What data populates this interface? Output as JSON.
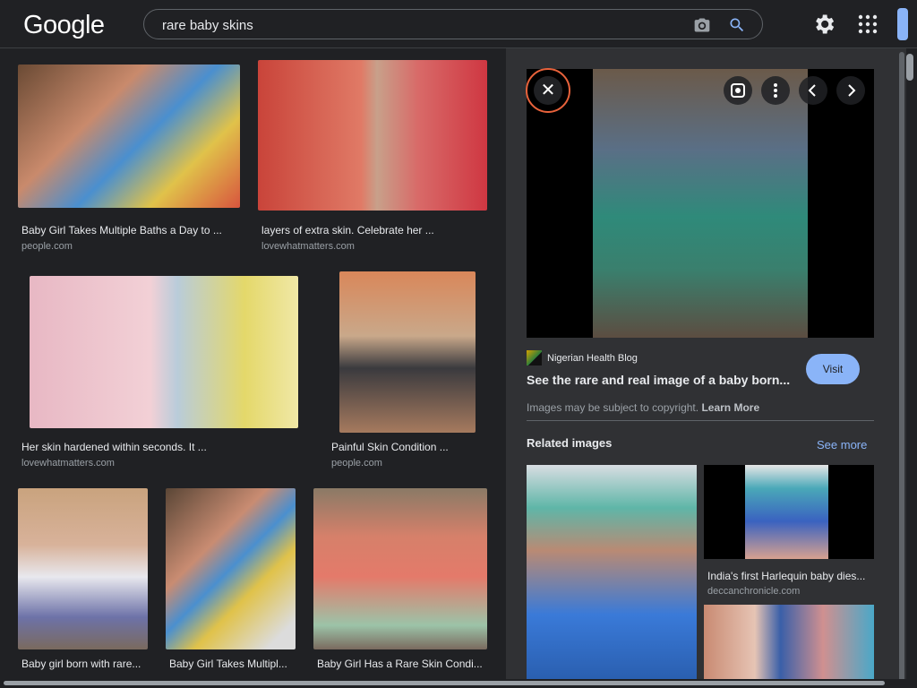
{
  "header": {
    "logo": "Google",
    "search_query": "rare baby skins",
    "camera_icon": "camera-icon",
    "search_icon": "search-icon",
    "settings_icon": "gear-icon",
    "apps_icon": "apps-grid-icon"
  },
  "results": [
    {
      "title": "Baby Girl Takes Multiple Baths a Day to ...",
      "source": "people.com"
    },
    {
      "title": "layers of extra skin. Celebrate her ...",
      "source": "lovewhatmatters.com"
    },
    {
      "title": "Her skin hardened within seconds. It ...",
      "source": "lovewhatmatters.com"
    },
    {
      "title": "Painful Skin Condition ...",
      "source": "people.com"
    },
    {
      "title": "Baby girl born with rare...",
      "source": ""
    },
    {
      "title": "Baby Girl Takes Multipl...",
      "source": ""
    },
    {
      "title": "Baby Girl Has a Rare Skin Condi...",
      "source": ""
    }
  ],
  "panel": {
    "site_name": "Nigerian Health Blog",
    "title": "See the rare and real image of a baby born...",
    "visit_label": "Visit",
    "copyright_text": "Images may be subject to copyright.",
    "learn_more": "Learn More",
    "related_heading": "Related images",
    "see_more": "See more",
    "related": [
      {
        "title": "",
        "source": ""
      },
      {
        "title": "India's first Harlequin baby dies...",
        "source": "deccanchronicle.com"
      },
      {
        "title": "",
        "source": ""
      }
    ],
    "close_icon": "close-icon",
    "lens_icon": "lens-icon",
    "more_icon": "more-vert-icon",
    "prev_icon": "chevron-left-icon",
    "next_icon": "chevron-right-icon"
  },
  "colors": {
    "background": "#202124",
    "panel": "#303134",
    "accent": "#8ab4f8",
    "close_ring": "#e8623b"
  }
}
